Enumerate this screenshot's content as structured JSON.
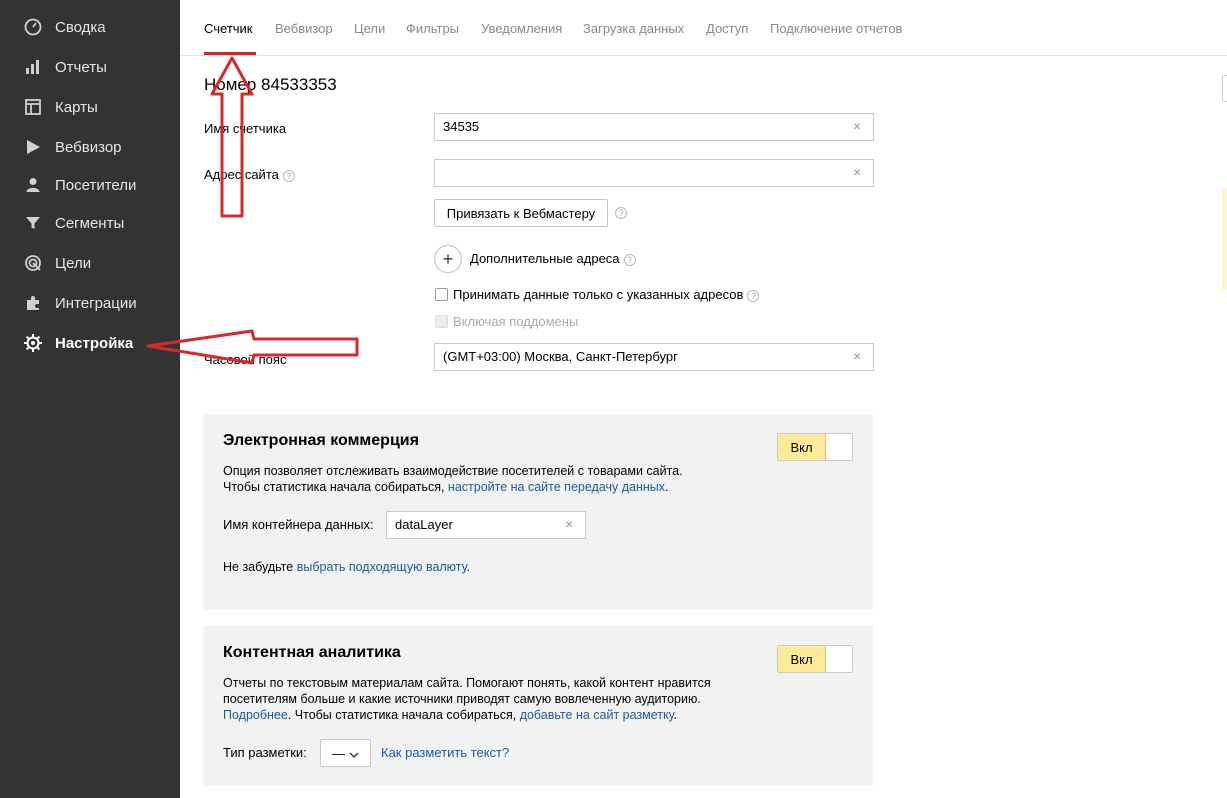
{
  "sidebar": {
    "items": [
      {
        "label": "Сводка",
        "icon": "dashboard-icon"
      },
      {
        "label": "Отчеты",
        "icon": "bar-chart-icon"
      },
      {
        "label": "Карты",
        "icon": "map-layout-icon"
      },
      {
        "label": "Вебвизор",
        "icon": "play-icon"
      },
      {
        "label": "Посетители",
        "icon": "user-icon"
      },
      {
        "label": "Сегменты",
        "icon": "filter-icon"
      },
      {
        "label": "Цели",
        "icon": "target-icon"
      },
      {
        "label": "Интеграции",
        "icon": "puzzle-icon"
      },
      {
        "label": "Настройка",
        "icon": "gear-icon",
        "active": true
      }
    ]
  },
  "tabs": [
    {
      "label": "Счетчик",
      "active": true
    },
    {
      "label": "Вебвизор"
    },
    {
      "label": "Цели"
    },
    {
      "label": "Фильтры"
    },
    {
      "label": "Уведомления"
    },
    {
      "label": "Загрузка данных"
    },
    {
      "label": "Доступ"
    },
    {
      "label": "Подключение отчетов"
    }
  ],
  "counter": {
    "title": "Номер 84533353",
    "name_label": "Имя счетчика",
    "name_value": "34535",
    "site_label": "Адрес сайта",
    "site_value": "",
    "webmaster_button": "Привязать к Вебмастеру",
    "extra_addresses": "Дополнительные адреса",
    "only_specified": "Принимать данные только с указанных адресов",
    "include_subdomains": "Включая поддомены",
    "timezone_label": "Часовой пояс",
    "timezone_value": "(GMT+03:00) Москва, Санкт-Петербург"
  },
  "ecommerce": {
    "title": "Электронная коммерция",
    "toggle_label": "Вкл",
    "desc_line1": "Опция позволяет отслеживать взаимодействие посетителей с товарами сайта.",
    "desc_line2_prefix": "Чтобы статистика начала собираться, ",
    "desc_line2_link": "настройте на сайте передачу данных",
    "desc_line2_suffix": ".",
    "container_label": "Имя контейнера данных:",
    "container_value": "dataLayer",
    "currency_prefix": "Не забудьте ",
    "currency_link": "выбрать подходящую валюту",
    "currency_suffix": "."
  },
  "content_analytics": {
    "title": "Контентная аналитика",
    "toggle_label": "Вкл",
    "desc_line1": "Отчеты по текстовым материалам сайта. Помогают понять, какой контент нравится",
    "desc_line2": "посетителям больше и какие источники приводят самую вовлеченную аудиторию.",
    "more_link": "Подробнее",
    "desc_line3_middle": ". Чтобы статистика начала собираться, ",
    "markup_link": "добавьте на сайт разметку",
    "desc_line3_suffix": ".",
    "markup_type_label": "Тип разметки:",
    "markup_type_value": "—",
    "how_to_link": "Как разметить текст?"
  },
  "colors": {
    "sidebar_bg": "#333333",
    "accent_red": "#e02020",
    "toggle_on": "#fdeb9a",
    "link": "#1a5ba6"
  }
}
